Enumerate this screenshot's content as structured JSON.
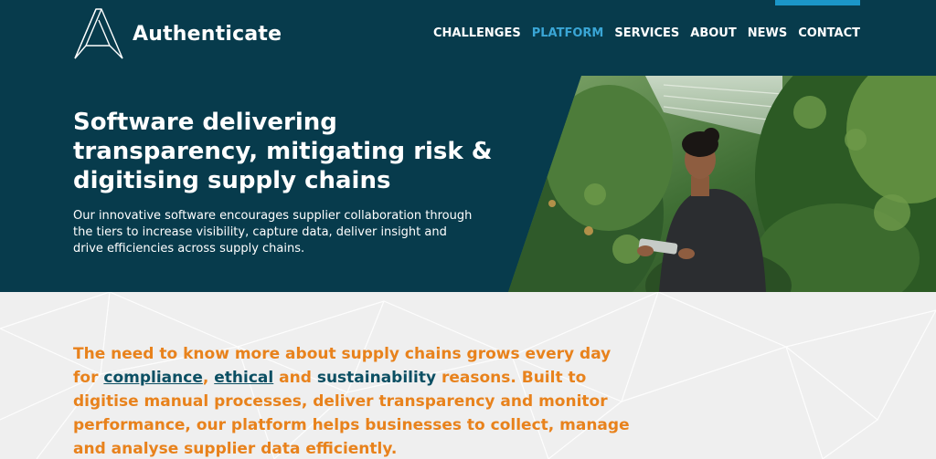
{
  "brand": {
    "name": "Authenticate"
  },
  "nav": {
    "items": [
      "CHALLENGES",
      "PLATFORM",
      "SERVICES",
      "ABOUT",
      "NEWS",
      "CONTACT"
    ],
    "active": "PLATFORM"
  },
  "hero": {
    "headline": "Software delivering transparency, mitigating risk & digitising supply chains",
    "lead": "Our innovative software encourages supplier collaboration through the tiers to increase visibility, capture data, deliver insight and drive efficiencies across supply chains."
  },
  "statement": {
    "part1": "The need to know more about supply chains grows every day for ",
    "link1": "compliance",
    "sep1": ", ",
    "link2": "ethical",
    "sep2": " and ",
    "term3": "sustainability",
    "part2": " reasons. Built to digitise manual processes, deliver transparency and monitor performance, our platform helps businesses to collect, manage and analyse supplier data efficiently."
  },
  "colors": {
    "hero_bg": "#073b4c",
    "accent": "#e8821c",
    "nav_active": "#3aa6d6",
    "link": "#0b4f63"
  }
}
